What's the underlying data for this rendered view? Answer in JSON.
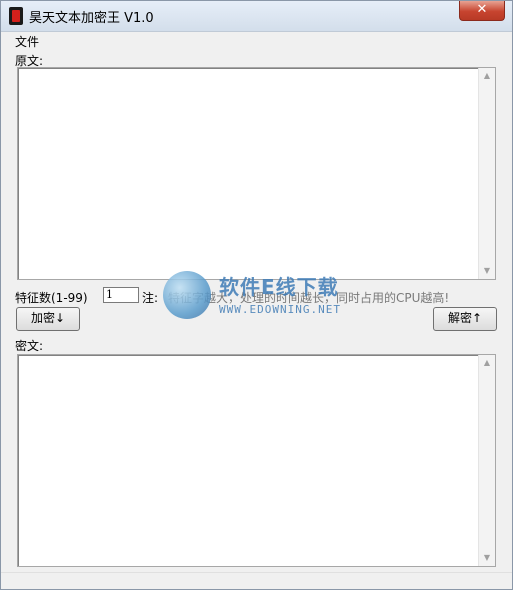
{
  "window": {
    "title": "昊天文本加密王 V1.0",
    "close_label": "✕"
  },
  "menu": {
    "file_label": "文件"
  },
  "original": {
    "label": "原文:",
    "value": ""
  },
  "feature": {
    "label": "特征数(1-99)",
    "value": "1",
    "note_prefix": "注:",
    "note_text": "特征字越大，处理的时间越长，同时占用的CPU越高!"
  },
  "buttons": {
    "encrypt_label": "加密↓",
    "decrypt_label": "解密↑"
  },
  "cipher": {
    "label": "密文:",
    "value": ""
  },
  "watermark": {
    "brand_cn": "软件E线下载",
    "brand_en": "WWW.EDOWNING.NET"
  },
  "scrollbar": {
    "up_icon": "triangle-up",
    "down_icon": "triangle-down"
  }
}
